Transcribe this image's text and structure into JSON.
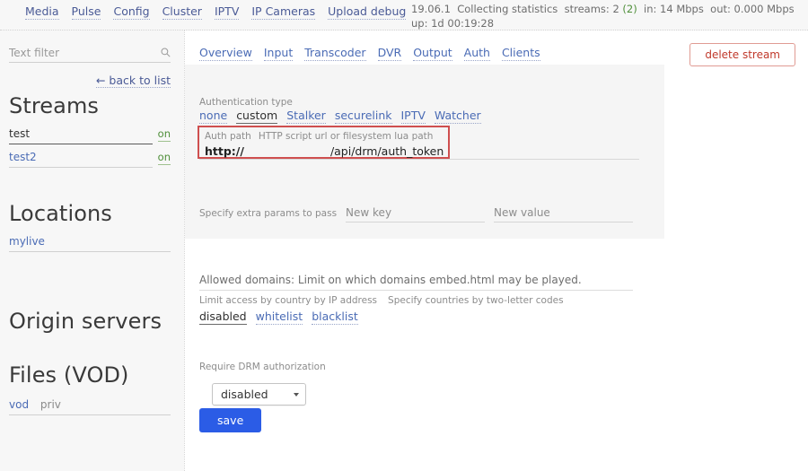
{
  "topnav": {
    "items": [
      {
        "label": "Media"
      },
      {
        "label": "Pulse"
      },
      {
        "label": "Config"
      },
      {
        "label": "Cluster"
      },
      {
        "label": "IPTV"
      },
      {
        "label": "IP Cameras"
      },
      {
        "label": "Upload debug"
      }
    ]
  },
  "status": {
    "version": "19.06.1",
    "collecting": "Collecting statistics",
    "streams_label": "streams:",
    "streams_count": "2",
    "streams_active": "(2)",
    "in": "in: 14 Mbps",
    "out": "out: 0.000 Mbps",
    "uptime": "up: 1d 00:19:28"
  },
  "sidebar": {
    "filter_placeholder": "Text filter",
    "filter_value": "",
    "back_label": "← back to list",
    "streams_title": "Streams",
    "streams": [
      {
        "name": "test",
        "state": "on"
      },
      {
        "name": "test2",
        "state": "on"
      }
    ],
    "locations_title": "Locations",
    "locations": [
      {
        "name": "mylive"
      }
    ],
    "origin_title": "Origin servers",
    "files_title": "Files (VOD)",
    "files": [
      {
        "name": "vod"
      },
      {
        "name": "priv"
      }
    ]
  },
  "main": {
    "tabs": [
      {
        "label": "Overview"
      },
      {
        "label": "Input"
      },
      {
        "label": "Transcoder"
      },
      {
        "label": "DVR"
      },
      {
        "label": "Output"
      },
      {
        "label": "Auth"
      },
      {
        "label": "Clients"
      }
    ],
    "delete_label": "delete stream",
    "auth_type": {
      "label": "Authentication type",
      "options": [
        {
          "label": "none",
          "active": false
        },
        {
          "label": "custom",
          "active": true
        },
        {
          "label": "Stalker",
          "active": false
        },
        {
          "label": "securelink",
          "active": false
        },
        {
          "label": "IPTV",
          "active": false
        },
        {
          "label": "Watcher",
          "active": false
        }
      ]
    },
    "auth_path": {
      "label": "Auth path",
      "hint": "HTTP script url or filesystem lua path",
      "value_prefix": "http://",
      "value_suffix": "/api/drm/auth_token"
    },
    "extra_params": {
      "label": "Specify extra params to pass",
      "key_placeholder": "New key",
      "key_value": "",
      "value_placeholder": "New value",
      "value_value": ""
    },
    "allowed_domains": "Allowed domains: Limit on which domains embed.html may be played.",
    "country": {
      "label": "Limit access by country by IP address",
      "hint": "Specify countries by two-letter codes",
      "options": [
        {
          "label": "disabled",
          "active": true
        },
        {
          "label": "whitelist",
          "active": false
        },
        {
          "label": "blacklist",
          "active": false
        }
      ]
    },
    "drm": {
      "label": "Require DRM authorization",
      "selected": "disabled"
    },
    "save_label": "save"
  },
  "colors": {
    "link": "#4a6bb5",
    "accent": "#2b5ce6",
    "danger": "#c0392b",
    "ok": "#4f8f3a"
  }
}
